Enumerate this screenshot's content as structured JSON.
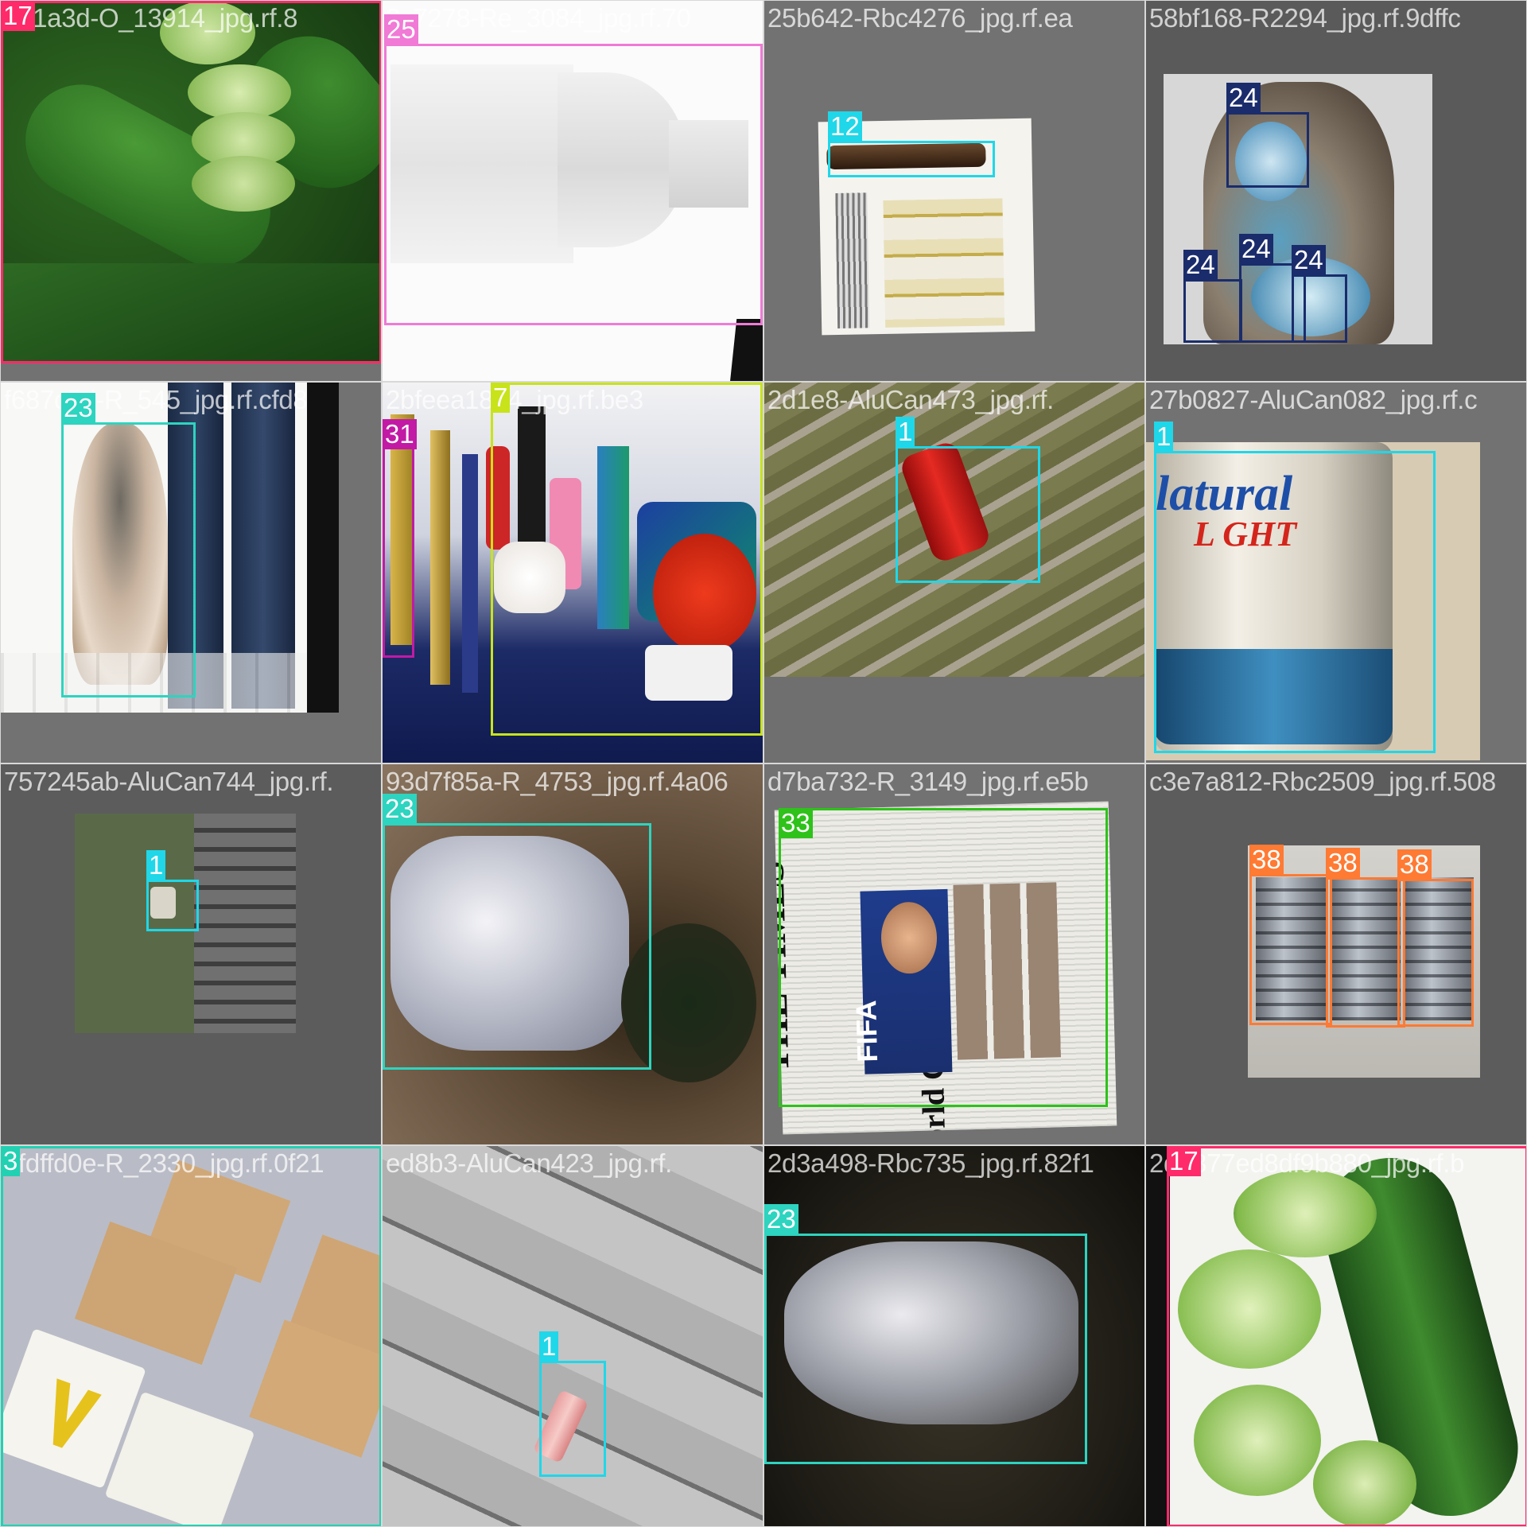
{
  "tiles": [
    {
      "filename": "2d1a3d-O_13914_jpg.rf.8",
      "scene": "cucumbers-sliced",
      "boxes": [
        {
          "class_id": "17",
          "color": "#ff2a6a"
        }
      ]
    },
    {
      "filename": "2c7278-Re_3084_jpg.rf.70",
      "scene": "plastic-bottle-white",
      "boxes": [
        {
          "class_id": "25",
          "color": "#f07ad6"
        }
      ]
    },
    {
      "filename": "25b642-Rbc4276_jpg.rf.ea",
      "scene": "brown-glass-bottle",
      "boxes": [
        {
          "class_id": "12",
          "color": "#1fd7e8"
        }
      ]
    },
    {
      "filename": "58bf168-R2294_jpg.rf.9dffc",
      "scene": "plastic-bag-blue",
      "boxes": [
        {
          "class_id": "24",
          "color": "#1a2c6b"
        },
        {
          "class_id": "24",
          "color": "#1a2c6b"
        },
        {
          "class_id": "24",
          "color": "#1a2c6b"
        },
        {
          "class_id": "24",
          "color": "#1a2c6b"
        }
      ]
    },
    {
      "filename": "f687c5d-R_545_jpg.rf.cfd8",
      "scene": "plastic-bag-jeans",
      "boxes": [
        {
          "class_id": "23",
          "color": "#2dd4bf"
        }
      ]
    },
    {
      "filename": "2bfeea1814_jpg.rf.be3",
      "scene": "mixed-plastics",
      "boxes": [
        {
          "class_id": "31",
          "color": "#c21aa5"
        },
        {
          "class_id": "7",
          "color": "#c8e31a"
        }
      ]
    },
    {
      "filename": "2d1e8-AluCan473_jpg.rf.",
      "scene": "red-can-deck",
      "boxes": [
        {
          "class_id": "1",
          "color": "#1fd7e8"
        }
      ]
    },
    {
      "filename": "27b0827-AluCan082_jpg.rf.c",
      "scene": "beer-can",
      "boxes": [
        {
          "class_id": "1",
          "color": "#1fd7e8"
        }
      ]
    },
    {
      "filename": "757245ab-AluCan744_jpg.rf.",
      "scene": "small-can-grass",
      "boxes": [
        {
          "class_id": "1",
          "color": "#1fd7e8"
        }
      ]
    },
    {
      "filename": "93d7f85a-R_4753_jpg.rf.4a06",
      "scene": "plastic-bag-soil",
      "boxes": [
        {
          "class_id": "23",
          "color": "#2dd4bf"
        }
      ]
    },
    {
      "filename": "d7ba732-R_3149_jpg.rf.e5b",
      "scene": "newspaper",
      "newspaper": {
        "masthead": "THE TIMES",
        "headline": "World Cup of fraud",
        "logo": "FIFA"
      },
      "boxes": [
        {
          "class_id": "33",
          "color": "#2ec21a"
        }
      ]
    },
    {
      "filename": "c3e7a812-Rbc2509_jpg.rf.508",
      "scene": "tin-cans",
      "boxes": [
        {
          "class_id": "38",
          "color": "#ff7a33"
        },
        {
          "class_id": "38",
          "color": "#ff7a33"
        },
        {
          "class_id": "38",
          "color": "#ff7a33"
        }
      ]
    },
    {
      "filename": "8fdffd0e-R_2330_jpg.rf.0f21",
      "scene": "cardboard-pieces",
      "boxes": [
        {
          "class_id": "3",
          "color": "#22d1b2"
        }
      ]
    },
    {
      "filename": "ed8b3-AluCan423_jpg.rf.",
      "scene": "crushed-can-deck",
      "boxes": [
        {
          "class_id": "1",
          "color": "#1fd7e8"
        }
      ]
    },
    {
      "filename": "2d3a498-Rbc735_jpg.rf.82f1",
      "scene": "plastic-film-dark",
      "boxes": [
        {
          "class_id": "23",
          "color": "#2dd4bf"
        }
      ]
    },
    {
      "filename": "2d6377ed8df9b880_jpg.rf.b",
      "scene": "cucumbers-plate",
      "boxes": [
        {
          "class_id": "17",
          "color": "#ff2a6a"
        }
      ]
    }
  ]
}
